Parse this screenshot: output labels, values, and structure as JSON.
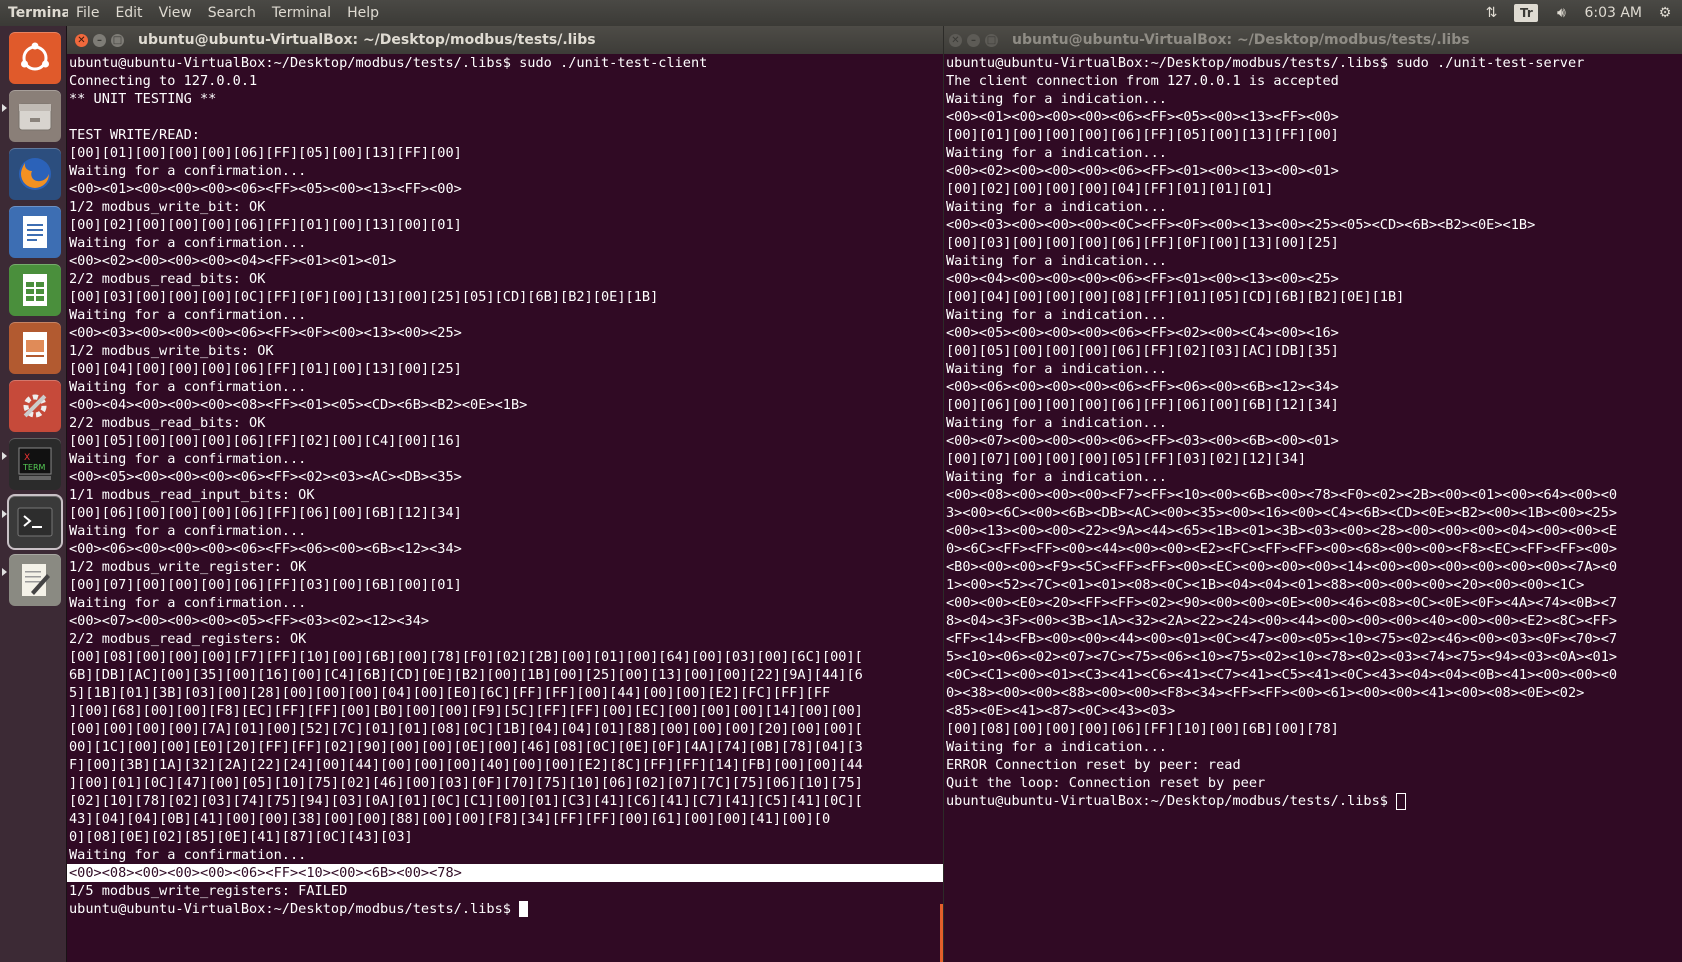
{
  "topbar": {
    "app_name": "Terminal",
    "menus": [
      "File",
      "Edit",
      "View",
      "Search",
      "Terminal",
      "Help"
    ],
    "keyboard_indicator": "Tr",
    "clock": "6:03 AM"
  },
  "launcher": {
    "items": [
      "dash-home",
      "file-manager",
      "firefox",
      "libreoffice-writer",
      "libreoffice-calc",
      "libreoffice-impress",
      "system-settings",
      "xterm",
      "terminal",
      "text-editor"
    ]
  },
  "left_window": {
    "title": "ubuntu@ubuntu-VirtualBox: ~/Desktop/modbus/tests/.libs",
    "lines": [
      "ubuntu@ubuntu-VirtualBox:~/Desktop/modbus/tests/.libs$ sudo ./unit-test-client",
      "Connecting to 127.0.0.1",
      "** UNIT TESTING **",
      "",
      "TEST WRITE/READ:",
      "[00][01][00][00][00][06][FF][05][00][13][FF][00]",
      "Waiting for a confirmation...",
      "<00><01><00><00><00><06><FF><05><00><13><FF><00>",
      "1/2 modbus_write_bit: OK",
      "[00][02][00][00][00][06][FF][01][00][13][00][01]",
      "Waiting for a confirmation...",
      "<00><02><00><00><00><04><FF><01><01><01>",
      "2/2 modbus_read_bits: OK",
      "[00][03][00][00][00][0C][FF][0F][00][13][00][25][05][CD][6B][B2][0E][1B]",
      "Waiting for a confirmation...",
      "<00><03><00><00><00><06><FF><0F><00><13><00><25>",
      "1/2 modbus_write_bits: OK",
      "[00][04][00][00][00][06][FF][01][00][13][00][25]",
      "Waiting for a confirmation...",
      "<00><04><00><00><00><08><FF><01><05><CD><6B><B2><0E><1B>",
      "2/2 modbus_read_bits: OK",
      "[00][05][00][00][00][06][FF][02][00][C4][00][16]",
      "Waiting for a confirmation...",
      "<00><05><00><00><00><06><FF><02><03><AC><DB><35>",
      "1/1 modbus_read_input_bits: OK",
      "[00][06][00][00][00][06][FF][06][00][6B][12][34]",
      "Waiting for a confirmation...",
      "<00><06><00><00><00><06><FF><06><00><6B><12><34>",
      "1/2 modbus_write_register: OK",
      "[00][07][00][00][00][06][FF][03][00][6B][00][01]",
      "Waiting for a confirmation...",
      "<00><07><00><00><00><05><FF><03><02><12><34>",
      "2/2 modbus_read_registers: OK",
      "[00][08][00][00][00][F7][FF][10][00][6B][00][78][F0][02][2B][00][01][00][64][00][03][00][6C][00][",
      "6B][DB][AC][00][35][00][16][00][C4][6B][CD][0E][B2][00][1B][00][25][00][13][00][00][22][9A][44][6",
      "5][1B][01][3B][03][00][28][00][00][00][04][00][E0][6C][FF][FF][00][44][00][00][E2][FC][FF][FF",
      "][00][68][00][00][F8][EC][FF][FF][00][B0][00][00][F9][5C][FF][FF][00][EC][00][00][00][14][00][00]",
      "[00][00][00][00][7A][01][00][52][7C][01][01][08][0C][1B][04][04][01][88][00][00][00][20][00][00][",
      "00][1C][00][00][E0][20][FF][FF][02][90][00][00][0E][00][46][08][0C][0E][0F][4A][74][0B][78][04][3",
      "F][00][3B][1A][32][2A][22][24][00][44][00][00][00][40][00][00][E2][8C][FF][FF][14][FB][00][00][44",
      "][00][01][0C][47][00][05][10][75][02][46][00][03][0F][70][75][10][06][02][07][7C][75][06][10][75]",
      "[02][10][78][02][03][74][75][94][03][0A][01][0C][C1][00][01][C3][41][C6][41][C7][41][C5][41][0C][",
      "43][04][04][0B][41][00][00][38][00][00][88][00][00][F8][34][FF][FF][00][61][00][00][41][00][0",
      "0][08][0E][02][85][0E][41][87][0C][43][03]",
      "Waiting for a confirmation...",
      "<00><08><00><00><00><06><FF><10><00><6B><00><78>",
      "1/5 modbus_write_registers: FAILED",
      "ubuntu@ubuntu-VirtualBox:~/Desktop/modbus/tests/.libs$ "
    ]
  },
  "right_window": {
    "title": "ubuntu@ubuntu-VirtualBox: ~/Desktop/modbus/tests/.libs",
    "lines": [
      "ubuntu@ubuntu-VirtualBox:~/Desktop/modbus/tests/.libs$ sudo ./unit-test-server",
      "The client connection from 127.0.0.1 is accepted",
      "Waiting for a indication...",
      "<00><01><00><00><00><06><FF><05><00><13><FF><00>",
      "[00][01][00][00][00][06][FF][05][00][13][FF][00]",
      "Waiting for a indication...",
      "<00><02><00><00><00><06><FF><01><00><13><00><01>",
      "[00][02][00][00][00][04][FF][01][01][01]",
      "Waiting for a indication...",
      "<00><03><00><00><00><0C><FF><0F><00><13><00><25><05><CD><6B><B2><0E><1B>",
      "[00][03][00][00][00][06][FF][0F][00][13][00][25]",
      "Waiting for a indication...",
      "<00><04><00><00><00><06><FF><01><00><13><00><25>",
      "[00][04][00][00][00][08][FF][01][05][CD][6B][B2][0E][1B]",
      "Waiting for a indication...",
      "<00><05><00><00><00><06><FF><02><00><C4><00><16>",
      "[00][05][00][00][00][06][FF][02][03][AC][DB][35]",
      "Waiting for a indication...",
      "<00><06><00><00><00><06><FF><06><00><6B><12><34>",
      "[00][06][00][00][00][06][FF][06][00][6B][12][34]",
      "Waiting for a indication...",
      "<00><07><00><00><00><06><FF><03><00><6B><00><01>",
      "[00][07][00][00][00][05][FF][03][02][12][34]",
      "Waiting for a indication...",
      "<00><08><00><00><00><F7><FF><10><00><6B><00><78><F0><02><2B><00><01><00><64><00><0",
      "3><00><6C><00><6B><DB><AC><00><35><00><16><00><C4><6B><CD><0E><B2><00><1B><00><25>",
      "<00><13><00><00><22><9A><44><65><1B><01><3B><03><00><28><00><00><00><04><00><00><E",
      "0><6C><FF><FF><00><44><00><00><E2><FC><FF><FF><00><68><00><00><F8><EC><FF><FF><00>",
      "<B0><00><00><F9><5C><FF><FF><00><EC><00><00><00><14><00><00><00><00><00><00><7A><0",
      "1><00><52><7C><01><01><08><0C><1B><04><04><01><88><00><00><00><20><00><00><1C>",
      "<00><00><E0><20><FF><FF><02><90><00><00><0E><00><46><08><0C><0E><0F><4A><74><0B><7",
      "8><04><3F><00><3B><1A><32><2A><22><24><00><44><00><00><00><40><00><00><E2><8C><FF>",
      "<FF><14><FB><00><00><44><00><01><0C><47><00><05><10><75><02><46><00><03><0F><70><7",
      "5><10><06><02><07><7C><75><06><10><75><02><10><78><02><03><74><75><94><03><0A><01>",
      "<0C><C1><00><01><C3><41><C6><41><C7><41><C5><41><0C><43><04><04><0B><41><00><00><0",
      "0><38><00><00><88><00><00><F8><34><FF><FF><00><61><00><00><41><00><08><0E><02>",
      "<85><0E><41><87><0C><43><03>",
      "[00][08][00][00][00][06][FF][10][00][6B][00][78]",
      "Waiting for a indication...",
      "ERROR Connection reset by peer: read",
      "Quit the loop: Connection reset by peer",
      "ubuntu@ubuntu-VirtualBox:~/Desktop/modbus/tests/.libs$ "
    ]
  }
}
